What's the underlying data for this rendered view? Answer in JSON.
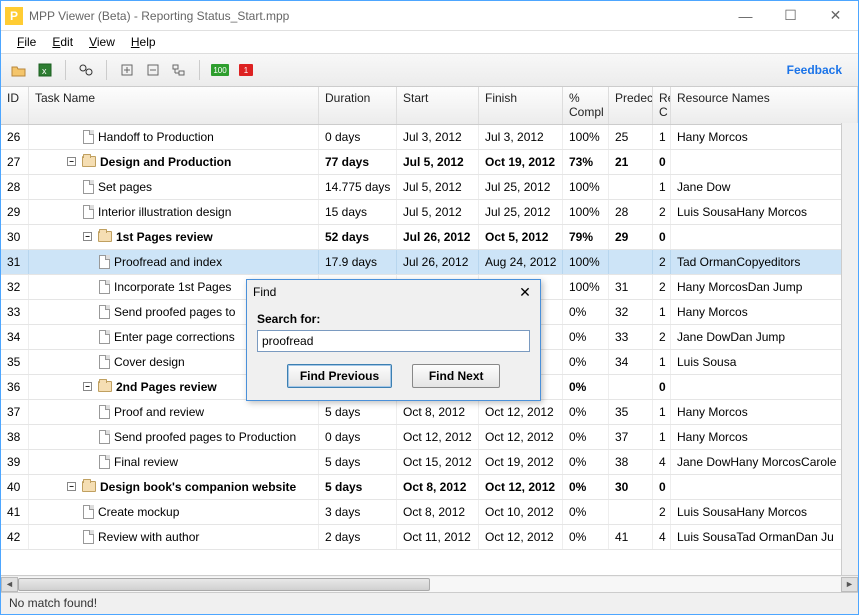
{
  "window": {
    "title": "MPP Viewer (Beta) - Reporting Status_Start.mpp",
    "app_letter": "P"
  },
  "menu": {
    "file": "File",
    "edit": "Edit",
    "view": "View",
    "help": "Help"
  },
  "toolbar": {
    "feedback": "Feedback",
    "badge_green": "100",
    "badge_red": "1"
  },
  "columns": {
    "id": "ID",
    "task": "Task Name",
    "duration": "Duration",
    "start": "Start",
    "finish": "Finish",
    "pct": "%",
    "pct2": "Compl",
    "pred": "Predec",
    "res": "Re",
    "res2": "C",
    "rnames": "Resource Names"
  },
  "rows": [
    {
      "id": "26",
      "task": "Handoff to Production",
      "indent": 2,
      "icon": "doc",
      "dur": "0 days",
      "start": "Jul 3, 2012",
      "finish": "Jul 3, 2012",
      "pct": "100%",
      "pred": "25",
      "res": "1",
      "rnames": "Hany Morcos"
    },
    {
      "id": "27",
      "task": "Design and Production",
      "indent": 1,
      "icon": "folder",
      "exp": true,
      "dur": "77 days",
      "start": "Jul 5, 2012",
      "finish": "Oct 19, 2012",
      "pct": "73%",
      "pred": "21",
      "res": "0",
      "rnames": "",
      "bold": true
    },
    {
      "id": "28",
      "task": "Set pages",
      "indent": 2,
      "icon": "doc",
      "dur": "14.775 days",
      "start": "Jul 5, 2012",
      "finish": "Jul 25, 2012",
      "pct": "100%",
      "pred": "",
      "res": "1",
      "rnames": "Jane Dow"
    },
    {
      "id": "29",
      "task": "Interior illustration design",
      "indent": 2,
      "icon": "doc",
      "dur": "15 days",
      "start": "Jul 5, 2012",
      "finish": "Jul 25, 2012",
      "pct": "100%",
      "pred": "28",
      "res": "2",
      "rnames": "Luis SousaHany Morcos"
    },
    {
      "id": "30",
      "task": "1st Pages review",
      "indent": 2,
      "icon": "folder",
      "exp": true,
      "dur": "52 days",
      "start": "Jul 26, 2012",
      "finish": "Oct 5, 2012",
      "pct": "79%",
      "pred": "29",
      "res": "0",
      "rnames": "",
      "bold": true
    },
    {
      "id": "31",
      "task": "Proofread and index",
      "indent": 3,
      "icon": "doc",
      "dur": "17.9 days",
      "start": "Jul 26, 2012",
      "finish": "Aug 24, 2012",
      "pct": "100%",
      "pred": "",
      "res": "2",
      "rnames": "Tad OrmanCopyeditors",
      "selected": true
    },
    {
      "id": "32",
      "task": "Incorporate 1st Pages",
      "indent": 3,
      "icon": "doc",
      "dur": "",
      "start": "",
      "finish": "12",
      "pct": "100%",
      "pred": "31",
      "res": "2",
      "rnames": "Hany MorcosDan Jump"
    },
    {
      "id": "33",
      "task": "Send proofed pages to",
      "indent": 3,
      "icon": "doc",
      "dur": "",
      "start": "",
      "finish": "12",
      "pct": "0%",
      "pred": "32",
      "res": "1",
      "rnames": "Hany Morcos"
    },
    {
      "id": "34",
      "task": "Enter page corrections",
      "indent": 3,
      "icon": "doc",
      "dur": "",
      "start": "",
      "finish": "12",
      "pct": "0%",
      "pred": "33",
      "res": "2",
      "rnames": "Jane DowDan Jump"
    },
    {
      "id": "35",
      "task": "Cover design",
      "indent": 3,
      "icon": "doc",
      "dur": "",
      "start": "",
      "finish": "12",
      "pct": "0%",
      "pred": "34",
      "res": "1",
      "rnames": "Luis Sousa"
    },
    {
      "id": "36",
      "task": "2nd Pages review",
      "indent": 2,
      "icon": "folder",
      "exp": true,
      "dur": "",
      "start": "",
      "finish": "12",
      "pct": "0%",
      "pred": "",
      "res": "0",
      "rnames": "",
      "bold": true
    },
    {
      "id": "37",
      "task": "Proof and review",
      "indent": 3,
      "icon": "doc",
      "dur": "5 days",
      "start": "Oct 8, 2012",
      "finish": "Oct 12, 2012",
      "pct": "0%",
      "pred": "35",
      "res": "1",
      "rnames": "Hany Morcos"
    },
    {
      "id": "38",
      "task": "Send proofed pages to Production",
      "indent": 3,
      "icon": "doc",
      "dur": "0 days",
      "start": "Oct 12, 2012",
      "finish": "Oct 12, 2012",
      "pct": "0%",
      "pred": "37",
      "res": "1",
      "rnames": "Hany Morcos"
    },
    {
      "id": "39",
      "task": "Final review",
      "indent": 3,
      "icon": "doc",
      "dur": "5 days",
      "start": "Oct 15, 2012",
      "finish": "Oct 19, 2012",
      "pct": "0%",
      "pred": "38",
      "res": "4",
      "rnames": "Jane DowHany MorcosCarole"
    },
    {
      "id": "40",
      "task": "Design book's companion website",
      "indent": 1,
      "icon": "folder",
      "exp": true,
      "dur": "5 days",
      "start": "Oct 8, 2012",
      "finish": "Oct 12, 2012",
      "pct": "0%",
      "pred": "30",
      "res": "0",
      "rnames": "",
      "bold": true
    },
    {
      "id": "41",
      "task": "Create mockup",
      "indent": 2,
      "icon": "doc",
      "dur": "3 days",
      "start": "Oct 8, 2012",
      "finish": "Oct 10, 2012",
      "pct": "0%",
      "pred": "",
      "res": "2",
      "rnames": "Luis SousaHany Morcos"
    },
    {
      "id": "42",
      "task": "Review with author",
      "indent": 2,
      "icon": "doc",
      "dur": "2 days",
      "start": "Oct 11, 2012",
      "finish": "Oct 12, 2012",
      "pct": "0%",
      "pred": "41",
      "res": "4",
      "rnames": "Luis SousaTad OrmanDan Ju"
    }
  ],
  "dialog": {
    "title": "Find",
    "label": "Search for:",
    "value": "proofread",
    "btn_prev": "Find Previous",
    "btn_next": "Find Next"
  },
  "status": "No match found!"
}
